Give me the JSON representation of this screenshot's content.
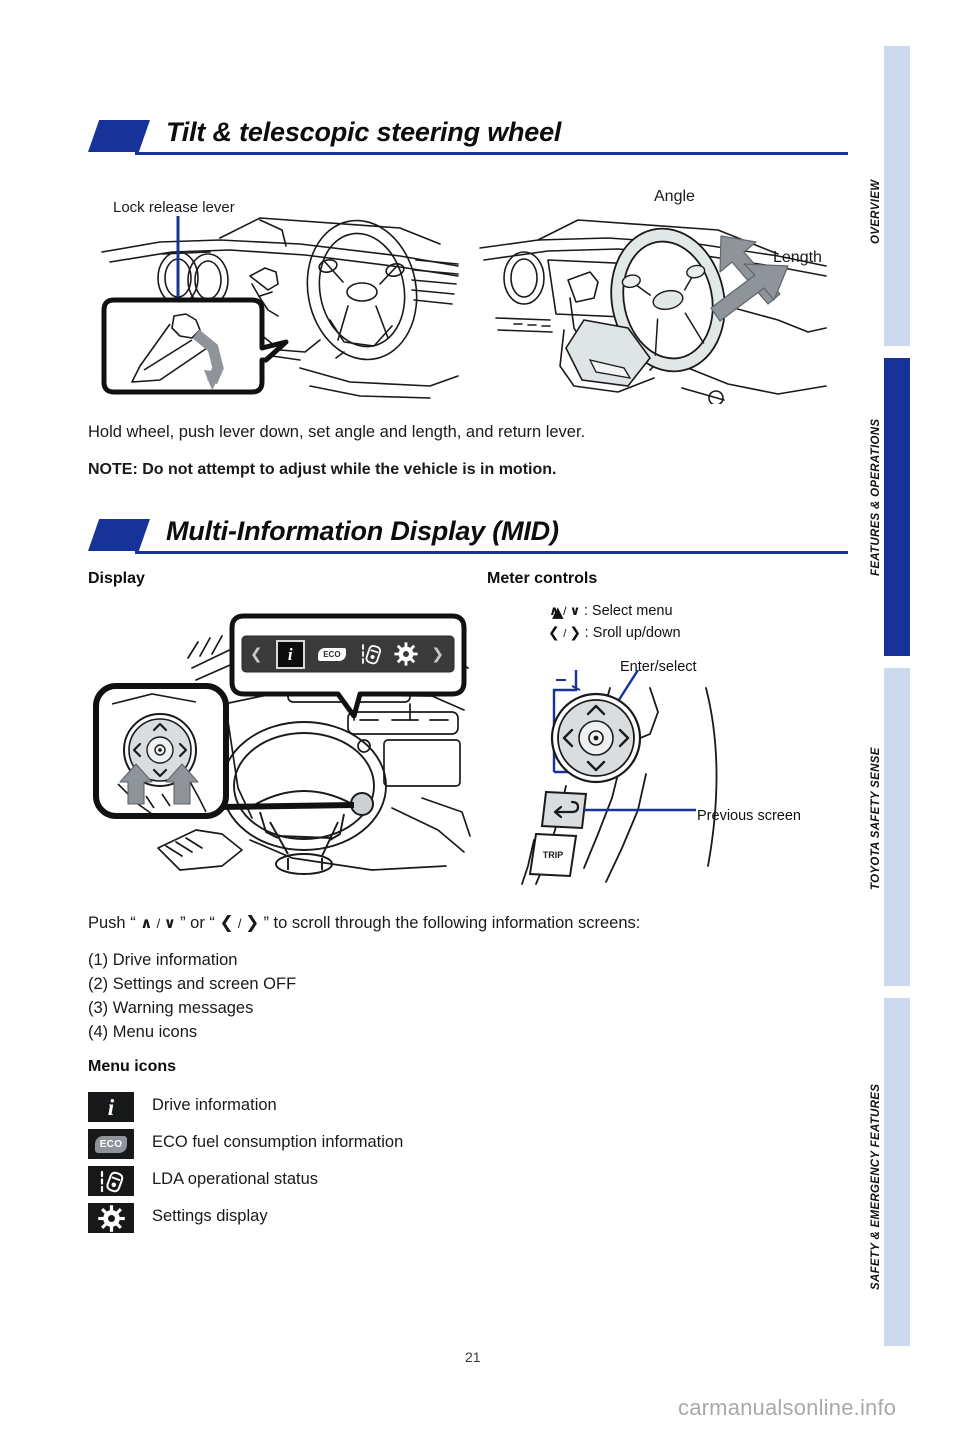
{
  "page": {
    "number": "21",
    "watermark": "carmanualsonline.info",
    "accent_color": "#17339a",
    "tab_inactive_color": "#ccd9ef"
  },
  "side_tabs": [
    {
      "label": "OVERVIEW",
      "active": false
    },
    {
      "label": "FEATURES & OPERATIONS",
      "active": true
    },
    {
      "label": "TOYOTA SAFETY SENSE",
      "active": false
    },
    {
      "label": "SAFETY & EMERGENCY FEATURES",
      "active": false
    }
  ],
  "sections": [
    {
      "title": "Tilt & telescopic steering wheel",
      "figure_labels": {
        "lock_release_lever": "Lock release lever",
        "angle": "Angle",
        "length": "Length"
      },
      "body": "Hold wheel, push lever down, set angle and length, and return lever.",
      "note": "NOTE: Do not attempt to adjust while the vehicle is in motion."
    },
    {
      "title": "Multi-Information Display (MID)",
      "subheads": {
        "display": "Display",
        "meter_controls": "Meter controls"
      },
      "meter_callouts": {
        "select_menu": ": Select menu",
        "scroll": ": Sroll up/down",
        "enter_select": "Enter/select",
        "previous_screen": "Previous screen",
        "trip_button": "TRIP"
      },
      "push_instruction": {
        "prefix": "Push “",
        "mid": "” or “",
        "suffix": "” to scroll through the following information screens:"
      },
      "screen_list": [
        "(1) Drive information",
        "(2) Settings and screen OFF",
        "(3) Warning messages",
        "(4) Menu icons"
      ],
      "menu_icons_head": "Menu icons",
      "menu_icons": [
        {
          "icon": "drive-information-icon",
          "glyph": "i",
          "label": "Drive information"
        },
        {
          "icon": "eco-icon",
          "glyph": "ECO",
          "label": "ECO fuel consumption information"
        },
        {
          "icon": "lda-icon",
          "glyph": "",
          "label": "LDA operational status"
        },
        {
          "icon": "settings-gear-icon",
          "glyph": "",
          "label": "Settings display"
        }
      ],
      "mid_screen_items": [
        "chevron-left-icon",
        "drive-information-icon",
        "eco-icon",
        "lda-icon",
        "settings-gear-icon",
        "chevron-right-icon"
      ]
    }
  ]
}
